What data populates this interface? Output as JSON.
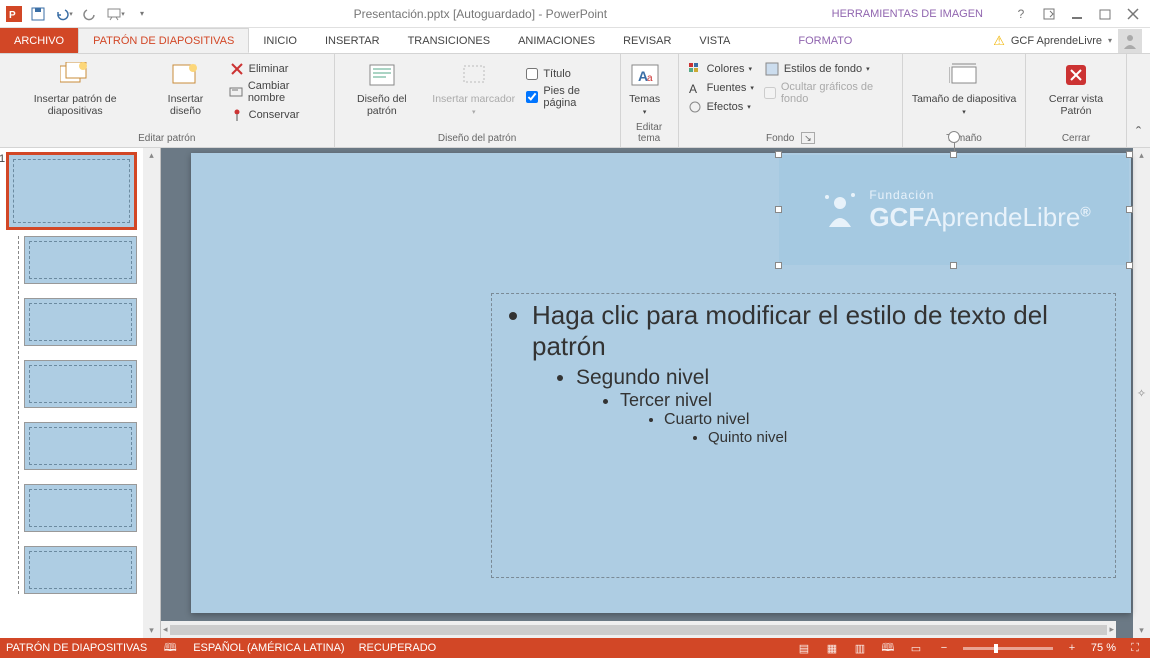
{
  "titlebar": {
    "title": "Presentación.pptx [Autoguardado] - PowerPoint",
    "tool_context": "HERRAMIENTAS DE IMAGEN"
  },
  "tabs": {
    "archivo": "ARCHIVO",
    "patron": "PATRÓN DE DIAPOSITIVAS",
    "inicio": "INICIO",
    "insertar": "INSERTAR",
    "transiciones": "TRANSICIONES",
    "animaciones": "ANIMACIONES",
    "revisar": "REVISAR",
    "vista": "VISTA",
    "formato": "FORMATO"
  },
  "user": {
    "name": "GCF AprendeLivre"
  },
  "ribbon": {
    "editar_patron": {
      "insertar_patron": "Insertar patrón de diapositivas",
      "insertar_diseno": "Insertar diseño",
      "eliminar": "Eliminar",
      "cambiar_nombre": "Cambiar nombre",
      "conservar": "Conservar",
      "label": "Editar patrón"
    },
    "diseno_patron": {
      "diseno": "Diseño del patrón",
      "insertar_marcador": "Insertar marcador",
      "titulo": "Título",
      "pies": "Pies de página",
      "label": "Diseño del patrón"
    },
    "editar_tema": {
      "temas": "Temas",
      "label": "Editar tema"
    },
    "fondo": {
      "colores": "Colores",
      "fuentes": "Fuentes",
      "efectos": "Efectos",
      "estilos": "Estilos de fondo",
      "ocultar": "Ocultar gráficos de fondo",
      "label": "Fondo"
    },
    "tamano": {
      "btn": "Tamaño de diapositiva",
      "label": "Tamaño"
    },
    "cerrar": {
      "btn": "Cerrar vista Patrón",
      "label": "Cerrar"
    }
  },
  "thumbs": {
    "master_num": "1"
  },
  "slide": {
    "logo_brand_top": "Fundación",
    "logo_brand": "GCFAprendeLibre",
    "ph": {
      "l1": "Haga clic para modificar el estilo de texto del patrón",
      "l2": "Segundo nivel",
      "l3": "Tercer nivel",
      "l4": "Cuarto nivel",
      "l5": "Quinto nivel"
    }
  },
  "statusbar": {
    "mode": "PATRÓN DE DIAPOSITIVAS",
    "lang": "ESPAÑOL (AMÉRICA LATINA)",
    "recovered": "RECUPERADO",
    "zoom": "75 %"
  }
}
